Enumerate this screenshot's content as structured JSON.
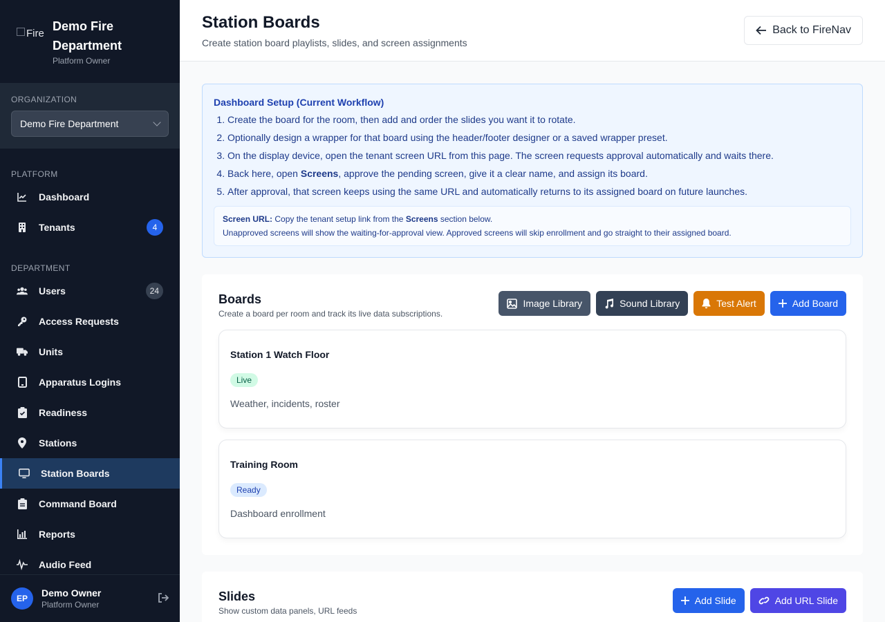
{
  "brand": {
    "logo_alt": "FireNav",
    "name": "Demo Fire Department",
    "role": "Platform Owner"
  },
  "organization": {
    "label": "ORGANIZATION",
    "selected": "Demo Fire Department"
  },
  "nav": {
    "platform_label": "PLATFORM",
    "platform_items": [
      {
        "label": "Dashboard",
        "icon": "chart-line-icon"
      },
      {
        "label": "Tenants",
        "icon": "building-icon",
        "badge": "4"
      }
    ],
    "department_label": "DEPARTMENT",
    "department_items": [
      {
        "label": "Users",
        "icon": "users-icon",
        "badge": "24"
      },
      {
        "label": "Access Requests",
        "icon": "key-icon"
      },
      {
        "label": "Units",
        "icon": "truck-icon"
      },
      {
        "label": "Apparatus Logins",
        "icon": "tablet-icon"
      },
      {
        "label": "Readiness",
        "icon": "clipboard-check-icon"
      },
      {
        "label": "Stations",
        "icon": "map-pin-icon"
      },
      {
        "label": "Station Boards",
        "icon": "monitor-icon",
        "active": true
      },
      {
        "label": "Command Board",
        "icon": "clipboard-icon"
      },
      {
        "label": "Reports",
        "icon": "bar-chart-icon"
      },
      {
        "label": "Audio Feed",
        "icon": "waveform-icon"
      }
    ]
  },
  "user": {
    "initials": "EP",
    "name": "Demo Owner",
    "role": "Platform Owner"
  },
  "header": {
    "title": "Station Boards",
    "subtitle": "Create station board playlists, slides, and screen assignments",
    "back_label": "Back to FireNav"
  },
  "setup": {
    "title": "Dashboard Setup (Current Workflow)",
    "step1": "Create the board for the room, then add and order the slides you want it to rotate.",
    "step2": "Optionally design a wrapper for that board using the header/footer designer or a saved wrapper preset.",
    "step3": "On the display device, open the tenant screen URL from this page. The screen requests approval automatically and waits there.",
    "step4_pre": "Back here, open ",
    "step4_bold": "Screens",
    "step4_post": ", approve the pending screen, give it a clear name, and assign its board.",
    "step5": "After approval, that screen keeps using the same URL and automatically returns to its assigned board on future launches.",
    "note_label": "Screen URL:",
    "note_pre": " Copy the tenant setup link from the ",
    "note_bold": "Screens",
    "note_post": " section below.",
    "note_line2": "Unapproved screens will show the waiting-for-approval view. Approved screens will skip enrollment and go straight to their assigned board."
  },
  "boards": {
    "title": "Boards",
    "subtitle": "Create a board per room and track its live data subscriptions.",
    "buttons": {
      "image_library": "Image Library",
      "sound_library": "Sound Library",
      "test_alert": "Test Alert",
      "add_board": "Add Board"
    },
    "items": [
      {
        "name": "Station 1 Watch Floor",
        "status": "Live",
        "desc": "Weather, incidents, roster"
      },
      {
        "name": "Training Room",
        "status": "Ready",
        "desc": "Dashboard enrollment"
      }
    ]
  },
  "slides": {
    "title": "Slides",
    "subtitle": "Show custom data panels, URL feeds",
    "add_slide": "Add Slide",
    "add_url_slide": "Add URL Slide"
  },
  "colors": {
    "sidebar_bg": "#111827",
    "accent": "#2563eb",
    "amber": "#d97706",
    "violet": "#4f46e5"
  }
}
